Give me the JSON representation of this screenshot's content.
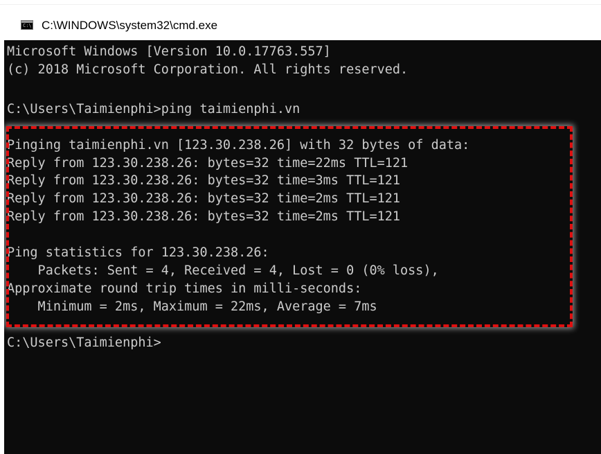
{
  "window": {
    "title": "C:\\WINDOWS\\system32\\cmd.exe",
    "icon": "cmd-icon",
    "icon_glyph": "C:\\"
  },
  "console": {
    "background_color": "#0c0c0c",
    "text_color": "#cccccc",
    "lines": [
      "Microsoft Windows [Version 10.0.17763.557]",
      "(c) 2018 Microsoft Corporation. All rights reserved.",
      "",
      "C:\\Users\\Taimienphi>ping taimienphi.vn",
      "",
      "Pinging taimienphi.vn [123.30.238.26] with 32 bytes of data:",
      "Reply from 123.30.238.26: bytes=32 time=22ms TTL=121",
      "Reply from 123.30.238.26: bytes=32 time=3ms TTL=121",
      "Reply from 123.30.238.26: bytes=32 time=2ms TTL=121",
      "Reply from 123.30.238.26: bytes=32 time=2ms TTL=121",
      "",
      "Ping statistics for 123.30.238.26:",
      "    Packets: Sent = 4, Received = 4, Lost = 0 (0% loss),",
      "Approximate round trip times in milli-seconds:",
      "    Minimum = 2ms, Maximum = 22ms, Average = 7ms",
      "",
      "C:\\Users\\Taimienphi>"
    ]
  },
  "annotation": {
    "highlight_color": "#e01010",
    "style": "dashed"
  }
}
